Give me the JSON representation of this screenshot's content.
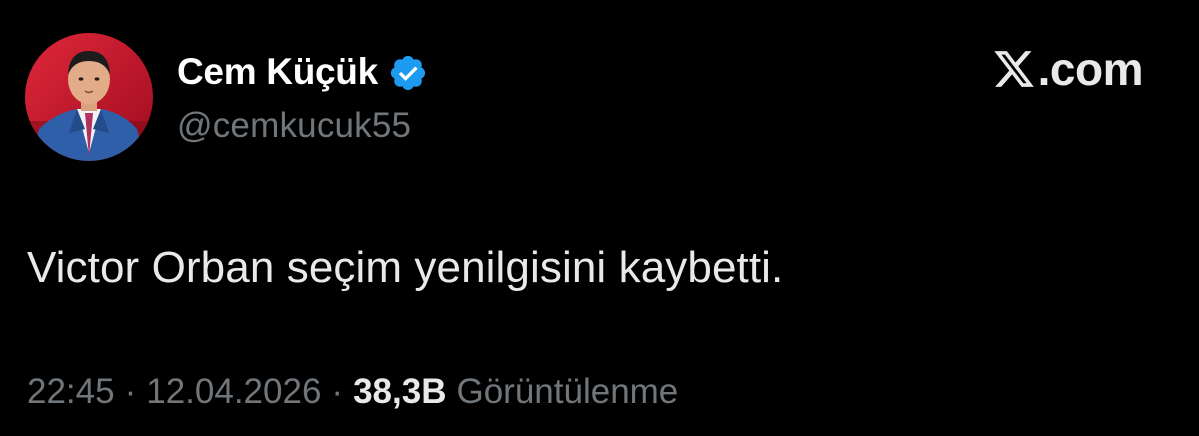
{
  "tweet": {
    "author": {
      "display_name": "Cem Küçük",
      "handle": "@cemkucuk55",
      "verified": true,
      "avatar_icon": "user-avatar-photo"
    },
    "brand": {
      "logo_icon": "x-logo-icon",
      "text": ".com"
    },
    "text": "Victor Orban seçim yenilgisini kaybetti.",
    "meta": {
      "time": "22:45",
      "separator": "·",
      "date": "12.04.2026",
      "views_count": "38,3B",
      "views_label": "Görüntülenme"
    }
  },
  "colors": {
    "background": "#000000",
    "primary_text": "#e7e9ea",
    "secondary_text": "#71767b",
    "verified_blue": "#1d9bf0",
    "avatar_background": "#c8102e"
  }
}
